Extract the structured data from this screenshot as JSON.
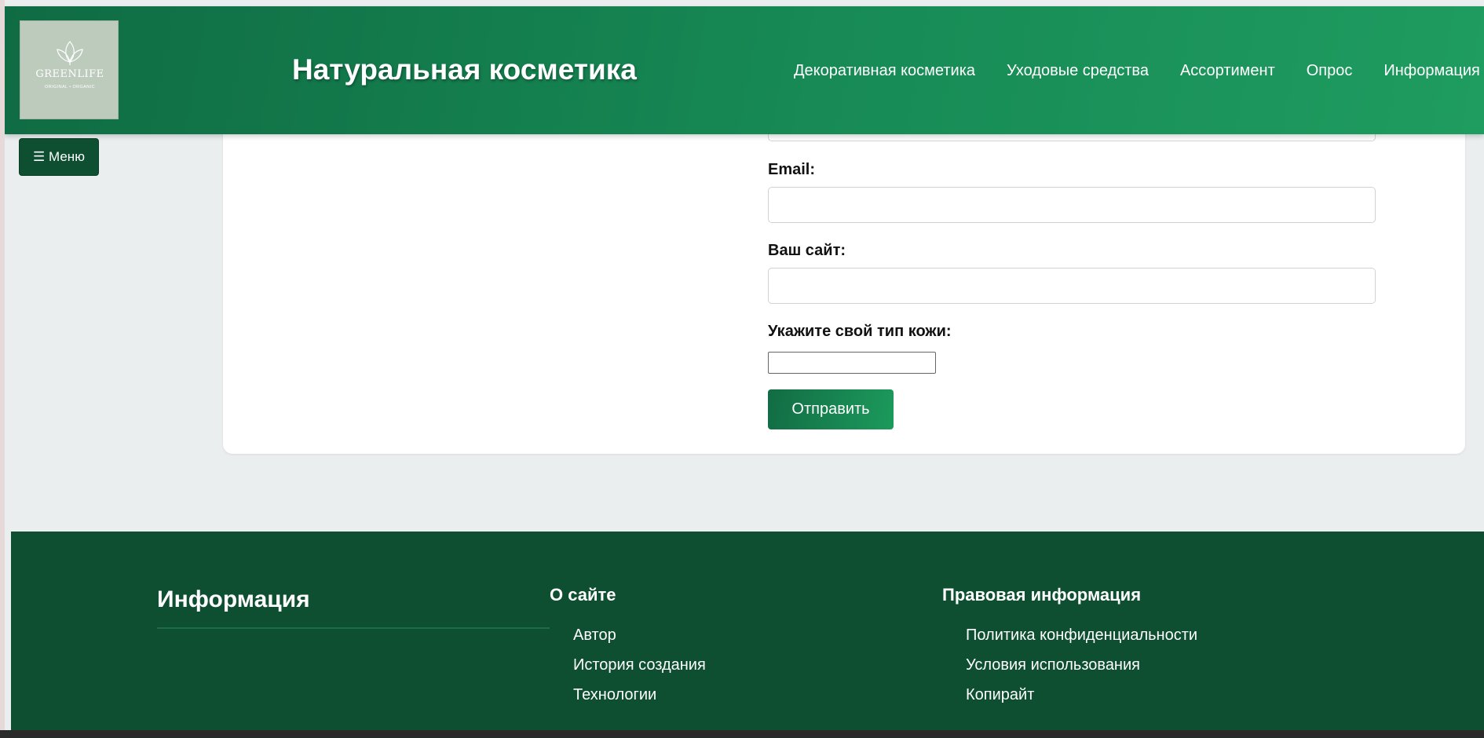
{
  "header": {
    "logo_text": "GREENLIFE",
    "logo_subtext": "ORIGINAL • ORGANIC",
    "site_title": "Натуральная косметика",
    "nav": [
      "Декоративная косметика",
      "Уходовые средства",
      "Ассортимент",
      "Опрос",
      "Информация"
    ]
  },
  "menu_button_label": "☰ Меню",
  "form": {
    "email_label": "Email:",
    "email_value": "",
    "website_label": "Ваш сайт:",
    "website_value": "",
    "skin_type_label": "Укажите свой тип кожи:",
    "skin_type_value": "",
    "submit_label": "Отправить"
  },
  "footer": {
    "heading": "Информация",
    "about": {
      "title": "О сайте",
      "links": [
        "Автор",
        "История создания",
        "Технологии"
      ]
    },
    "legal": {
      "title": "Правовая информация",
      "links": [
        "Политика конфиденциальности",
        "Условия использования",
        "Копирайт"
      ]
    }
  },
  "colors": {
    "header_start": "#0f6b43",
    "header_end": "#1f9c60",
    "footer_bg": "#0d4f30",
    "page_bg": "#ebeeef"
  }
}
